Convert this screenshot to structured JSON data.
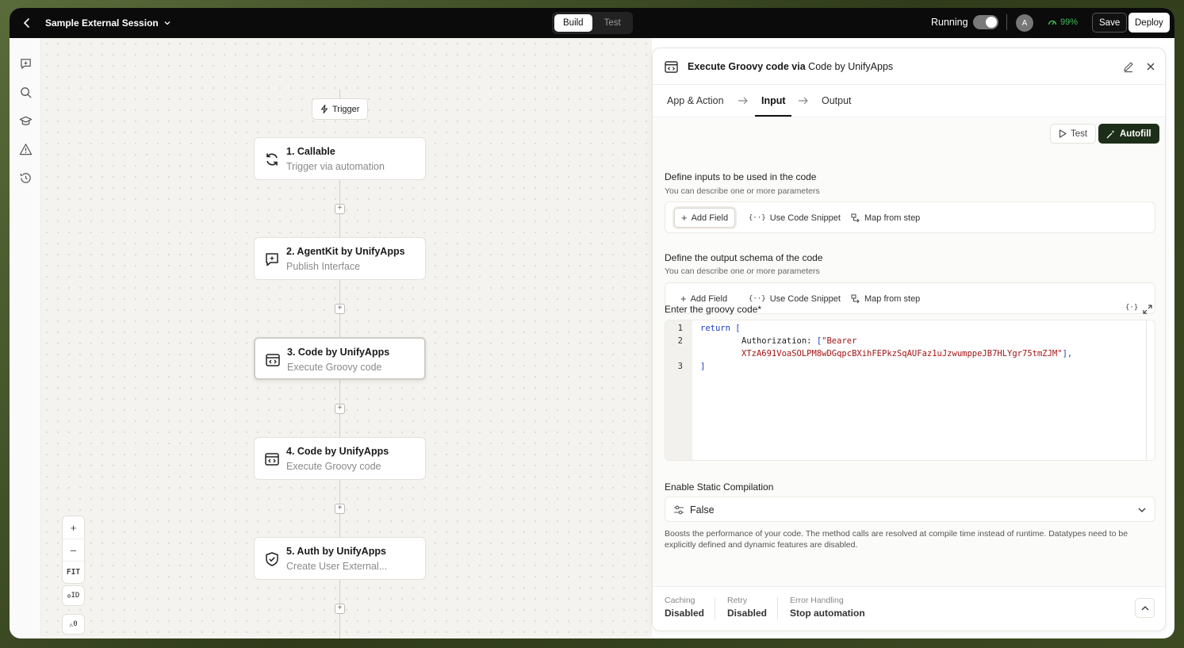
{
  "topbar": {
    "title": "Sample External Session",
    "mode_tabs": [
      "Build",
      "Test"
    ],
    "active_mode": "Build",
    "status_label": "Running",
    "avatar_initial": "A",
    "health": "99%",
    "save_label": "Save",
    "deploy_label": "Deploy"
  },
  "canvas": {
    "trigger_label": "Trigger",
    "nodes": [
      {
        "title": "1. Callable",
        "subtitle": "Trigger via automation",
        "icon": "refresh-icon"
      },
      {
        "title": "2. AgentKit by UnifyApps",
        "subtitle": "Publish Interface",
        "icon": "agent-chat-icon"
      },
      {
        "title": "3. Code by UnifyApps",
        "subtitle": "Execute Groovy code",
        "icon": "code-window-icon"
      },
      {
        "title": "4. Code by UnifyApps",
        "subtitle": "Execute Groovy code",
        "icon": "code-window-icon"
      },
      {
        "title": "5. Auth by UnifyApps",
        "subtitle": "Create User External...",
        "icon": "shield-check-icon"
      }
    ],
    "zoom": {
      "in": "+",
      "out": "–",
      "fit": "FIT"
    },
    "chips": {
      "id": "ID",
      "warnings": "0"
    }
  },
  "panel": {
    "title_prefix": "Execute Groovy code via",
    "title_app": "Code by UnifyApps",
    "tabs": [
      "App & Action",
      "Input",
      "Output"
    ],
    "active_tab": "Input",
    "test_label": "Test",
    "autofill_label": "Autofill",
    "inputs": {
      "title": "Define inputs to be used in the code",
      "subtitle": "You can describe one or more parameters",
      "buttons": [
        "Add Field",
        "Use Code Snippet",
        "Map from step"
      ]
    },
    "outputs": {
      "title": "Define the output schema of the code",
      "subtitle": "You can describe one or more parameters",
      "buttons": [
        "Add Field",
        "Use Code Snippet",
        "Map from step"
      ]
    },
    "code": {
      "label": "Enter the groovy code*",
      "line_numbers": [
        "1",
        "2",
        "3"
      ],
      "line1_kw": "return",
      "line1_rest": " [",
      "line2_key": "Authorization: ",
      "line2_open": "[",
      "line2_str_a": "\"Bearer",
      "line2_str_b": "XTzA691VoaSOLPM8wDGqpcBXihFEPkzSqAUFaz1uJzwumppeJB7HLYgr75tmZJM\"",
      "line2_close": "],",
      "line3": "]"
    },
    "static_compilation": {
      "label": "Enable Static Compilation",
      "value": "False",
      "help": "Boosts the performance of your code. The method calls are resolved at compile time instead of runtime. Datatypes need to be explicitly defined and dynamic features are disabled."
    },
    "footer": {
      "caching_label": "Caching",
      "caching_value": "Disabled",
      "retry_label": "Retry",
      "retry_value": "Disabled",
      "error_label": "Error Handling",
      "error_value": "Stop automation"
    }
  },
  "colors": {
    "topbar_bg": "#0b0b0b",
    "autofill_bg": "#1d2e18",
    "health_green": "#3fbf5a",
    "keyword_blue": "#1f3fbf",
    "string_red": "#a31515"
  }
}
